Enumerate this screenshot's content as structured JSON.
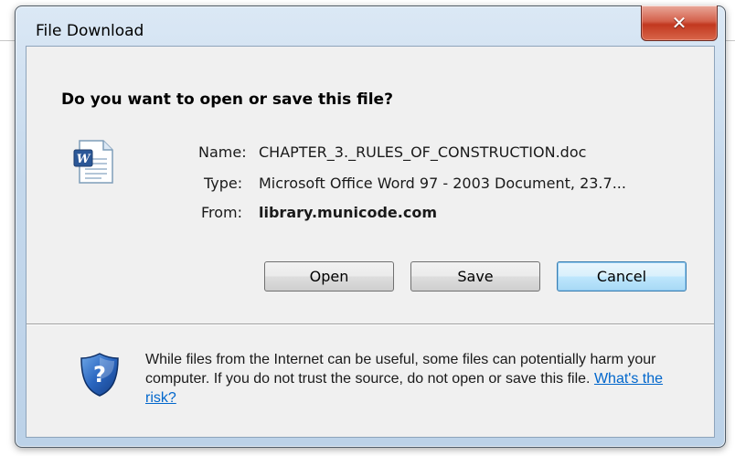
{
  "window": {
    "title": "File Download"
  },
  "dialog": {
    "question": "Do you want to open or save this file?",
    "file": {
      "name_label": "Name:",
      "name": "CHAPTER_3._RULES_OF_CONSTRUCTION.doc",
      "type_label": "Type:",
      "type": "Microsoft Office Word 97 - 2003 Document, 23.7...",
      "from_label": "From:",
      "from": "library.municode.com"
    },
    "buttons": {
      "open": "Open",
      "save": "Save",
      "cancel": "Cancel"
    },
    "warning": {
      "text": "While files from the Internet can be useful, some files can potentially harm your computer. If you do not trust the source, do not open or save this file. ",
      "link": "What's the risk?"
    }
  },
  "icons": {
    "file": "word-document-icon",
    "warning": "security-shield-icon",
    "close": "close-icon"
  },
  "colors": {
    "close_button": "#c9402a",
    "link": "#0066cc",
    "default_button_border": "#3c7fb1"
  }
}
